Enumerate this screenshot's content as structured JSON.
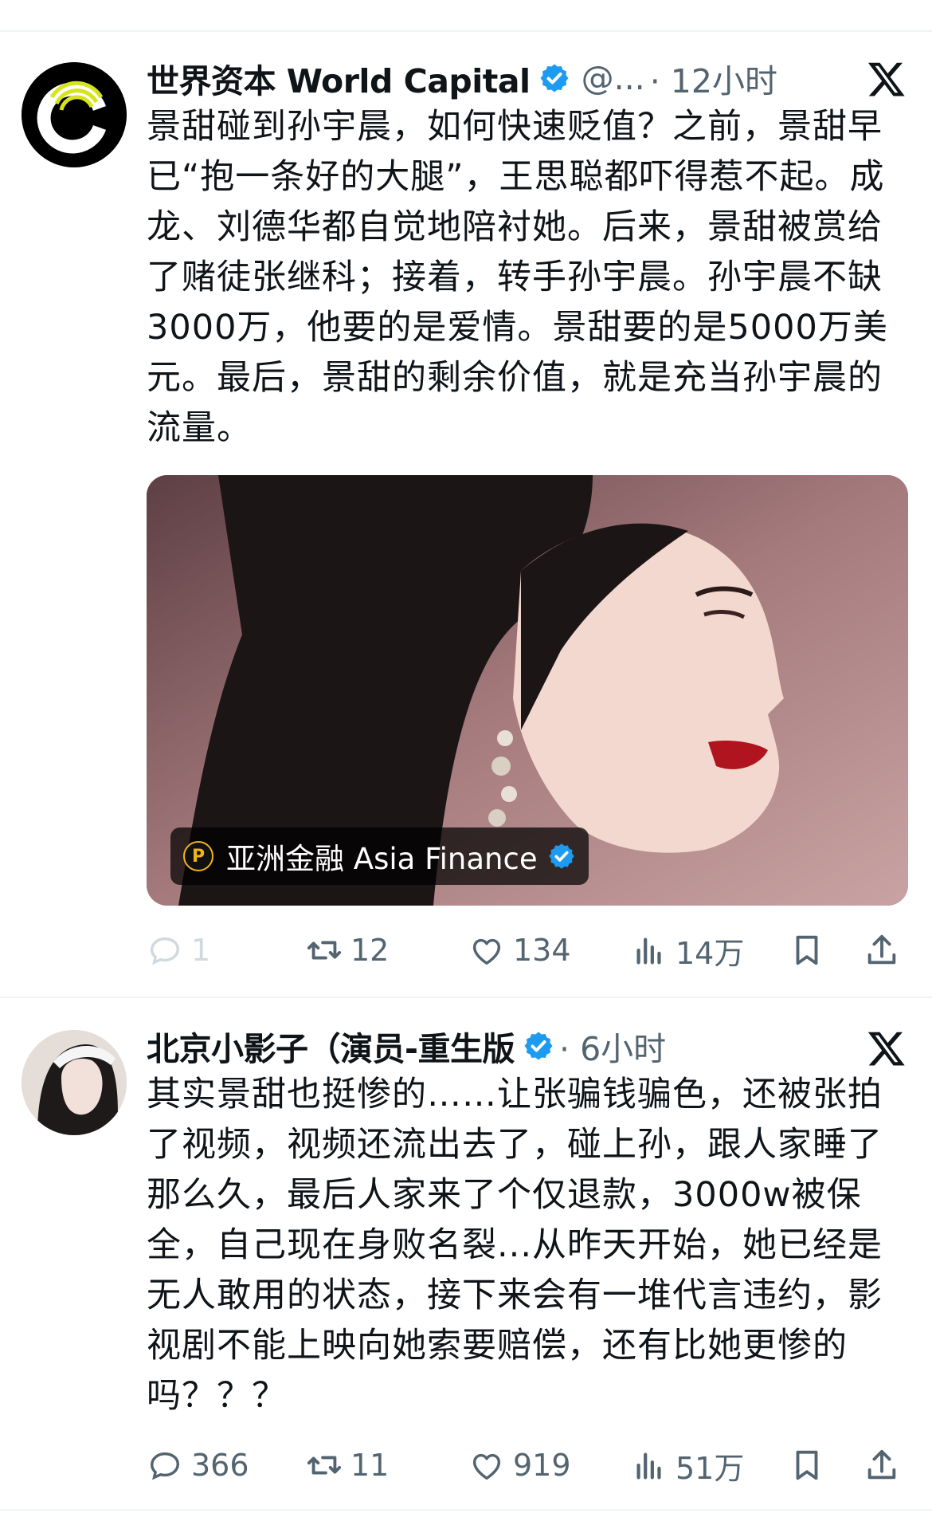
{
  "tweets": [
    {
      "author_name": "世界资本 World Capital",
      "handle": "@...",
      "time": "· 12小时",
      "text": "景甜碰到孙宇晨，如何快速贬值？之前，景甜早已“抱一条好的大腿”，王思聪都吓得惹不起。成龙、刘德华都自觉地陪衬她。后来，景甜被赏给了赌徒张继科；接着，转手孙宇晨。孙宇晨不缺3000万，他要的是爱情。景甜要的是5000万美元。最后，景甜的剩余价值，就是充当孙宇晨的流量。",
      "media_badge": "亚洲金融 Asia Finance",
      "replies": "1",
      "reposts": "12",
      "likes": "134",
      "views": "14万"
    },
    {
      "author_name": "北京小影子（演员-重生版",
      "time": "· 6小时",
      "text": "其实景甜也挺惨的……让张骗钱骗色，还被张拍了视频，视频还流出去了，碰上孙，跟人家睡了那么久，最后人家来了个仅退款，3000w被保全，自己现在身败名裂...从昨天开始，她已经是无人敢用的状态，接下来会有一堆代言违约，影视剧不能上映向她索要赔偿，还有比她更惨的吗？？？",
      "replies": "366",
      "reposts": "11",
      "likes": "919",
      "views": "51万"
    }
  ],
  "colors": {
    "verified": "#1d9bf0",
    "muted": "#536471",
    "text": "#0f1419"
  },
  "icons": [
    "verified-badge-icon",
    "x-logo-icon",
    "reply-icon",
    "repost-icon",
    "like-icon",
    "views-icon",
    "bookmark-icon",
    "share-icon"
  ]
}
